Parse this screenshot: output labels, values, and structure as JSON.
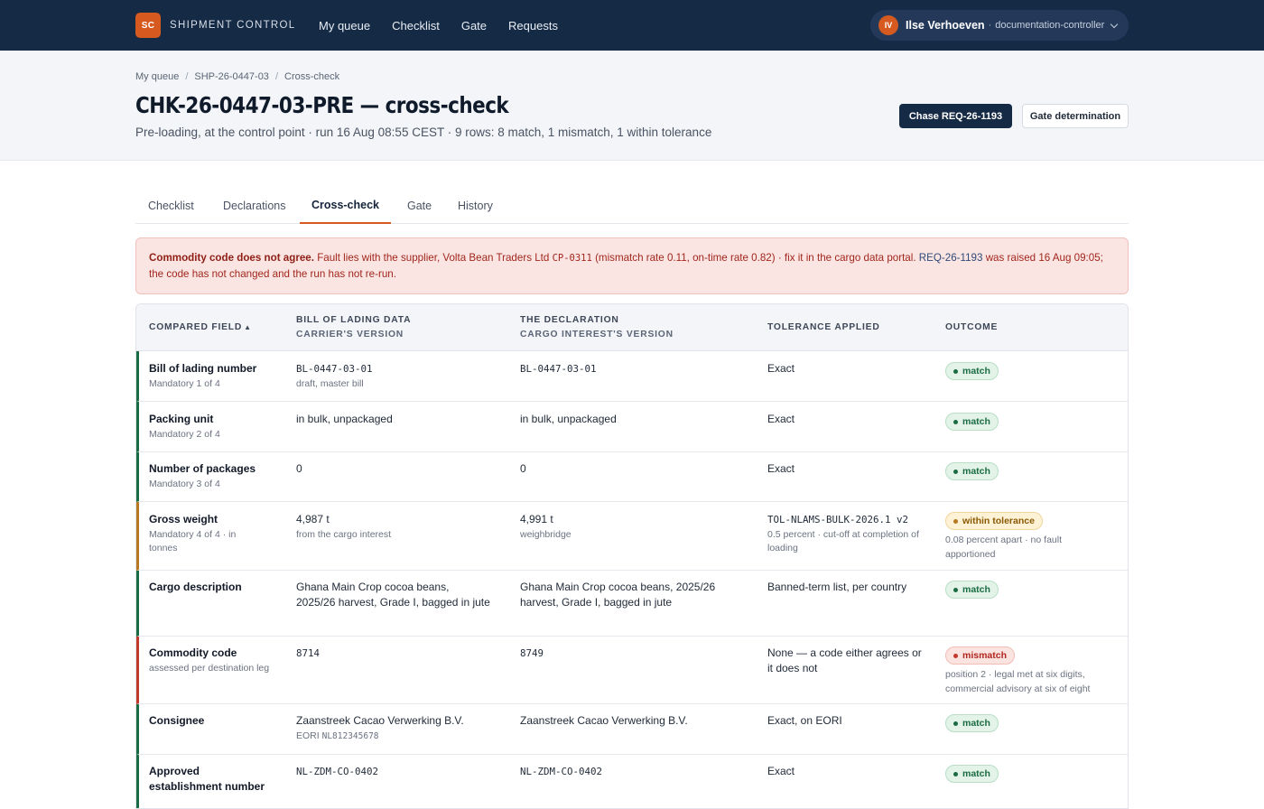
{
  "app": {
    "logo": "SC",
    "name": "SHIPMENT CONTROL",
    "nav": [
      "My queue",
      "Checklist",
      "Gate",
      "Requests"
    ],
    "user": {
      "initials": "IV",
      "name": "Ilse Verhoeven",
      "separator": "·",
      "role": "documentation-controller",
      "icon": "chevron-down-icon"
    }
  },
  "breadcrumb": [
    "My queue",
    "SHP-26-0447-03",
    "Cross-check"
  ],
  "page": {
    "title": "CHK-26-0447-03-PRE — cross-check",
    "subtitle": "Pre-loading, at the control point · run 16 Aug 08:55 CEST · 9 rows: 8 match, 1 mismatch, 1 within tolerance",
    "primary_action": "Chase REQ-26-1193",
    "secondary_action": "Gate determination"
  },
  "tabs": [
    "Checklist",
    "Declarations",
    "Cross-check",
    "Gate",
    "History"
  ],
  "active_tab": "Cross-check",
  "alert": {
    "heading": "Commodity code does not agree.",
    "text1": "Fault lies with the supplier, Volta Bean Traders Ltd",
    "supplier_code": "CP-0311",
    "text2": "(mismatch rate 0.11, on-time rate 0.82) · fix it in the cargo data portal.",
    "request_ref": "REQ-26-1193",
    "text3": "was raised 16 Aug 09:05; the code has not changed and the run has not re-run."
  },
  "table": {
    "columns": {
      "field": "COMPARED FIELD",
      "sort_indicator": "▲",
      "bl_title": "BILL OF LADING DATA",
      "bl_sub": "CARRIER'S VERSION",
      "decl_title": "THE DECLARATION",
      "decl_sub": "CARGO INTEREST'S VERSION",
      "tolerance": "TOLERANCE APPLIED",
      "outcome": "OUTCOME"
    },
    "rows": [
      {
        "field": "Bill of lading number",
        "field_sub": "Mandatory 1 of 4",
        "bl": "BL-0447-03-01",
        "bl_sub": "draft, master bill",
        "decl": "BL-0447-03-01",
        "decl_sub": "",
        "tolerance": "Exact",
        "tolerance_sub": "",
        "outcome": "match",
        "outcome_note": ""
      },
      {
        "field": "Packing unit",
        "field_sub": "Mandatory 2 of 4",
        "bl": "in bulk, unpackaged",
        "bl_sub": "",
        "decl": "in bulk, unpackaged",
        "decl_sub": "",
        "tolerance": "Exact",
        "tolerance_sub": "",
        "outcome": "match",
        "outcome_note": ""
      },
      {
        "field": "Number of packages",
        "field_sub": "Mandatory 3 of 4",
        "bl": "0",
        "bl_sub": "",
        "decl": "0",
        "decl_sub": "",
        "tolerance": "Exact",
        "tolerance_sub": "",
        "outcome": "match",
        "outcome_note": ""
      },
      {
        "field": "Gross weight",
        "field_sub": "Mandatory 4 of 4 · in tonnes",
        "bl": "4,987 t",
        "bl_sub": "from the cargo interest",
        "decl": "4,991 t",
        "decl_sub": "weighbridge",
        "tolerance": "TOL-NLAMS-BULK-2026.1 v2",
        "tolerance_sub": "0.5 percent · cut-off at completion of loading",
        "outcome": "within tolerance",
        "outcome_note": "0.08 percent apart · no fault apportioned"
      },
      {
        "field": "Cargo description",
        "field_sub": "",
        "bl": "Ghana Main Crop cocoa beans, 2025/26 harvest, Grade I, bagged in jute",
        "bl_sub": "",
        "decl": "Ghana Main Crop cocoa beans, 2025/26 harvest, Grade I, bagged in jute",
        "decl_sub": "",
        "tolerance": "Banned-term list, per country",
        "tolerance_sub": "",
        "outcome": "match",
        "outcome_note": ""
      },
      {
        "field": "Commodity code",
        "field_sub": "assessed per destination leg",
        "bl": "8714",
        "bl_sub": "",
        "decl": "8749",
        "decl_sub": "",
        "tolerance": "None — a code either agrees or it does not",
        "tolerance_sub": "",
        "outcome": "mismatch",
        "outcome_note": "position 2 · legal met at six digits, commercial advisory at six of eight"
      },
      {
        "field": "Consignee",
        "field_sub": "",
        "bl": "Zaanstreek Cacao Verwerking B.V.",
        "bl_sub_label": "EORI",
        "bl_sub_code": "NL812345678",
        "decl": "Zaanstreek Cacao Verwerking B.V.",
        "decl_sub": "",
        "tolerance": "Exact, on EORI",
        "tolerance_sub": "",
        "outcome": "match",
        "outcome_note": ""
      },
      {
        "field": "Approved establishment number",
        "field_sub": "",
        "bl": "NL-ZDM-CO-0402",
        "bl_sub": "",
        "decl": "NL-ZDM-CO-0402",
        "decl_sub": "",
        "tolerance": "Exact",
        "tolerance_sub": "",
        "outcome": "match",
        "outcome_note": ""
      }
    ]
  },
  "colors": {
    "navy": "#152a45",
    "accent": "#d65a1f",
    "match": "#1a6b43",
    "tolerance": "#b7791f",
    "mismatch": "#c0392b"
  }
}
